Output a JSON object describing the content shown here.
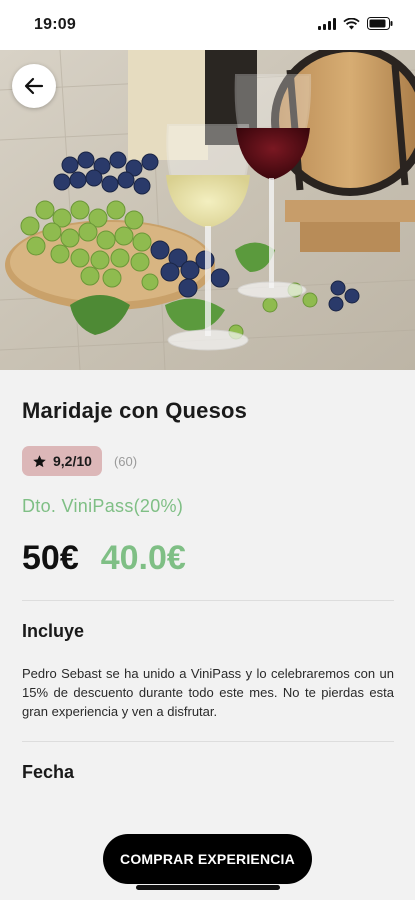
{
  "status_bar": {
    "time": "19:09"
  },
  "hero": {
    "image": "wine-and-grapes-photo"
  },
  "product": {
    "title": "Maridaje con Quesos",
    "rating": "9,2/10",
    "rating_count": "(60)",
    "discount_label": "Dto. ViniPass(20%)",
    "price_original": "50€",
    "price_final": "40.0€"
  },
  "sections": {
    "includes_title": "Incluye",
    "includes_text": "Pedro Sebast se ha unido a ViniPass y lo celebraremos con un 15% de descuento durante todo este mes. No te pierdas esta gran experiencia y ven a disfrutar.",
    "date_title": "Fecha"
  },
  "actions": {
    "buy_label": "COMPRAR EXPERIENCIA"
  },
  "colors": {
    "accent_green": "#7fbf85",
    "badge_pink": "#dcb7b8",
    "background": "#f2f2f2"
  }
}
